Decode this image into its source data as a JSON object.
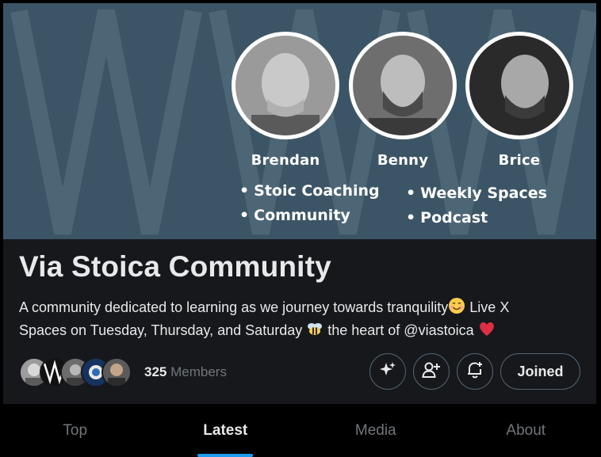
{
  "banner": {
    "hosts": [
      {
        "name": "Brendan"
      },
      {
        "name": "Benny"
      },
      {
        "name": "Brice"
      }
    ],
    "bullets_left": [
      "Stoic Coaching",
      "Community"
    ],
    "bullets_right": [
      "Weekly Spaces",
      "Podcast"
    ]
  },
  "community": {
    "title": "Via Stoica Community",
    "description_line1": "A community dedicated to learning as we journey towards tranquility",
    "description_line1_after": " Live X",
    "description_line2": "Spaces on Tuesday, Thursday, and Saturday ",
    "description_line2_after": " the heart of @viastoica "
  },
  "members": {
    "count": "325",
    "label": "Members"
  },
  "actions": {
    "joined_label": "Joined"
  },
  "tabs": [
    {
      "label": "Top",
      "active": false
    },
    {
      "label": "Latest",
      "active": true
    },
    {
      "label": "Media",
      "active": false
    },
    {
      "label": "About",
      "active": false
    }
  ],
  "colors": {
    "accent": "#1d9bf0",
    "banner_bg": "#3c5566"
  }
}
